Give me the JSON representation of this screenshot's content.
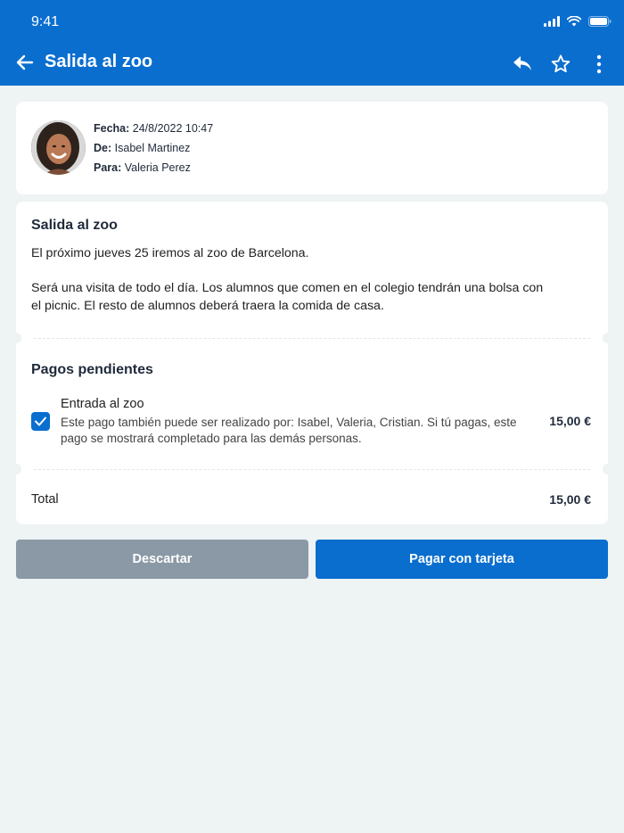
{
  "status_bar": {
    "time": "9:41"
  },
  "header": {
    "title": "Salida al zoo"
  },
  "meta": {
    "fecha_label": "Fecha:",
    "fecha_value": "24/8/2022 10:47",
    "de_label": "De:",
    "de_value": "Isabel Martinez",
    "para_label": "Para:",
    "para_value": "Valeria Perez"
  },
  "message": {
    "title": "Salida al zoo",
    "paragraph1": "El próximo jueves 25 iremos al zoo de Barcelona.",
    "paragraph2_line1": "Será una visita de todo el día. Los alumnos que comen en el colegio tendrán una bolsa con",
    "paragraph2_line2": "el picnic. El resto de alumnos deberá traera la comida de casa."
  },
  "payments": {
    "title": "Pagos pendientes",
    "items": [
      {
        "name": "Entrada al zoo",
        "description": "Este pago también puede ser realizado por: Isabel, Valeria, Cristian. Si tú pagas, este pago se mostrará completado para las demás personas.",
        "amount": "15,00 €",
        "checked": true
      }
    ],
    "total_label": "Total",
    "total_amount": "15,00 €"
  },
  "actions": {
    "discard_label": "Descartar",
    "pay_label": "Pagar con tarjeta"
  },
  "colors": {
    "primary": "#0a6ecf",
    "discard": "#8b99a6",
    "background": "#eef3f4"
  }
}
